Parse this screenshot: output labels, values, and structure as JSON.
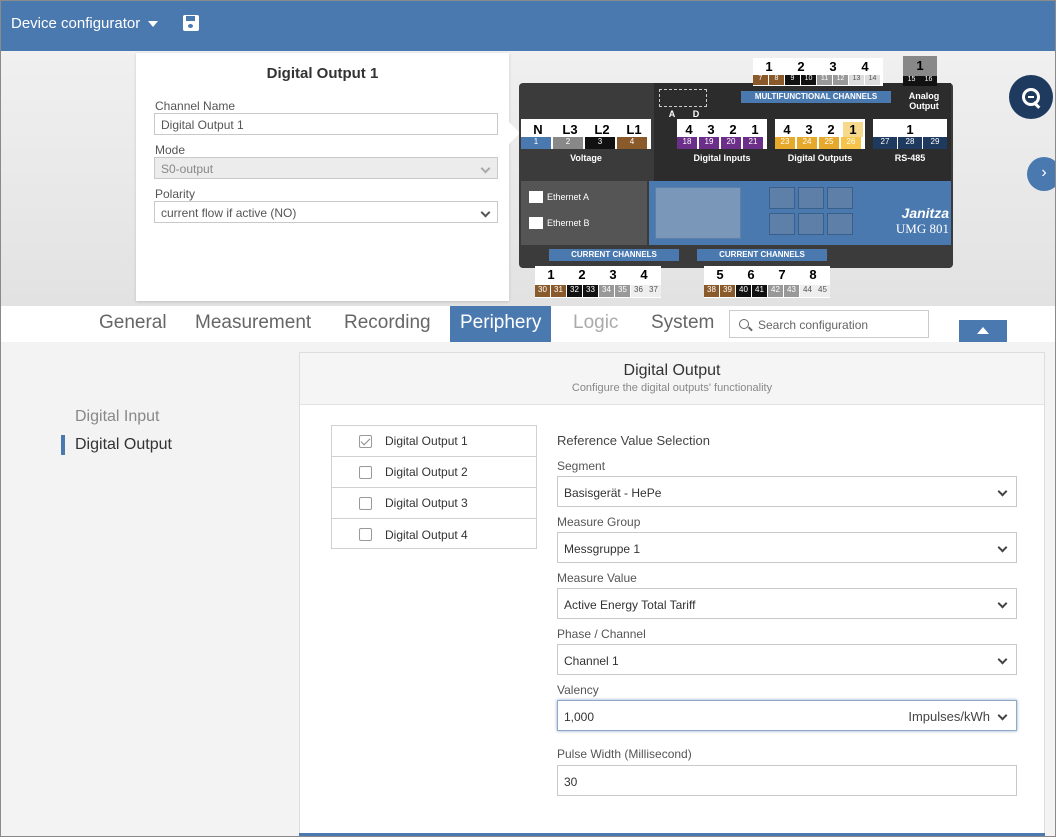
{
  "topbar": {
    "title": "Device configurator",
    "save_icon": "save-icon"
  },
  "config_card": {
    "title": "Digital Output 1",
    "channel_name_label": "Channel Name",
    "channel_name_value": "Digital Output 1",
    "mode_label": "Mode",
    "mode_value": "S0-output",
    "polarity_label": "Polarity",
    "polarity_value": "current flow if active (NO)"
  },
  "device": {
    "brand": "Janitza",
    "model": "UMG 801",
    "voltage_label": "Voltage",
    "voltage_terms": [
      "N",
      "L3",
      "L2",
      "L1"
    ],
    "voltage_nums": [
      "1",
      "2",
      "3",
      "4"
    ],
    "digital_inputs_label": "Digital Inputs",
    "digital_inputs_terms": [
      "4",
      "3",
      "2",
      "1"
    ],
    "digital_inputs_nums": [
      "18",
      "19",
      "20",
      "21"
    ],
    "digital_outputs_label": "Digital Outputs",
    "digital_outputs_terms": [
      "4",
      "3",
      "2",
      "1"
    ],
    "digital_outputs_nums": [
      "23",
      "24",
      "25",
      "26"
    ],
    "rs485_label": "RS-485",
    "rs485_term": "1",
    "rs485_nums": [
      "27",
      "28",
      "29"
    ],
    "multifunctional_label": "MULTIFUNCTIONAL CHANNELS",
    "multifunctional_terms": [
      "1",
      "2",
      "3",
      "4"
    ],
    "multifunctional_nums": [
      "7",
      "8",
      "9",
      "10",
      "11",
      "12",
      "13",
      "14"
    ],
    "analog_label": "Analog Output",
    "analog_term": "1",
    "analog_nums": [
      "15",
      "16"
    ],
    "ethernet_a": "Ethernet A",
    "ethernet_b": "Ethernet B",
    "current_label": "CURRENT CHANNELS",
    "current_terms_1": [
      "1",
      "2",
      "3",
      "4"
    ],
    "current_nums_1": [
      "30",
      "31",
      "32",
      "33",
      "34",
      "35",
      "36",
      "37"
    ],
    "current_terms_2": [
      "5",
      "6",
      "7",
      "8"
    ],
    "current_nums_2": [
      "38",
      "39",
      "40",
      "41",
      "42",
      "43",
      "44",
      "45"
    ],
    "ad_labels": [
      "A",
      "D"
    ]
  },
  "tabs": [
    {
      "label": "General"
    },
    {
      "label": "Measurement"
    },
    {
      "label": "Recording"
    },
    {
      "label": "Periphery"
    },
    {
      "label": "Logic"
    },
    {
      "label": "System"
    }
  ],
  "search": {
    "placeholder": "Search configuration"
  },
  "sidebar": {
    "items": [
      {
        "label": "Digital Input"
      },
      {
        "label": "Digital Output"
      }
    ]
  },
  "panel": {
    "title": "Digital Output",
    "subtitle": "Configure the digital outputs' functionality",
    "outputs": [
      "Digital Output 1",
      "Digital Output 2",
      "Digital Output 3",
      "Digital Output 4"
    ],
    "ref_title": "Reference Value Selection",
    "segment_label": "Segment",
    "segment_value": "Basisgerät - HePe",
    "measure_group_label": "Measure Group",
    "measure_group_value": "Messgruppe 1",
    "measure_value_label": "Measure Value",
    "measure_value_value": "Active Energy Total Tariff",
    "phase_label": "Phase / Channel",
    "phase_value": "Channel 1",
    "valency_label": "Valency",
    "valency_value": "1,000",
    "valency_unit": "Impulses/kWh",
    "pulse_label": "Pulse Width (Millisecond)",
    "pulse_value": "30"
  }
}
